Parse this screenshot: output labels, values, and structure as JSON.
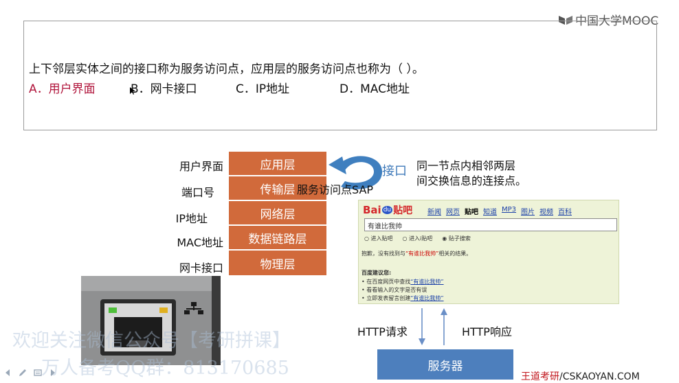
{
  "logo": {
    "text": "中国大学MOOC"
  },
  "question": {
    "text": "上下邻层实体之间的接口称为服务访问点，应用层的服务访问点也称为（        ）。",
    "options": [
      {
        "label": "A．用户界面"
      },
      {
        "label": "B．网卡接口"
      },
      {
        "label": "C．IP地址"
      },
      {
        "label": "D．MAC地址"
      }
    ]
  },
  "layers": [
    {
      "name": "应用层",
      "label": "用户界面"
    },
    {
      "name": "传输层",
      "label": "端口号"
    },
    {
      "name": "网络层",
      "label": "IP地址"
    },
    {
      "name": "数据链路层",
      "label": "MAC地址"
    },
    {
      "name": "物理层",
      "label": "网卡接口"
    }
  ],
  "sap_label": "服务访问点SAP",
  "interface_label": "接口",
  "interface_desc": [
    "同一节点内相邻两层",
    "间交换信息的连接点。"
  ],
  "baidu": {
    "logo_text": "Bai",
    "logo_paw": "du",
    "logo_tieba": "贴吧",
    "nav": [
      "新闻",
      "网页",
      "贴吧",
      "知道",
      "MP3",
      "图片",
      "视频",
      "百科"
    ],
    "search_value": "有谁比我帅",
    "radios": [
      "进入贴吧",
      "进入i贴吧",
      "贴子搜索"
    ],
    "sorry_prefix": "抱歉，没有找到与",
    "sorry_keyword": "“有谁比我帅”",
    "sorry_suffix": "相关的结果。",
    "suggest_title": "百度建议您:",
    "suggest_1_prefix": "在百度网页中查找",
    "suggest_1_link": "“有谁比我帅”",
    "suggest_2": "看看输入的文字是否有误",
    "suggest_3_prefix": "立即发表留言创建",
    "suggest_3_link": "“有谁比我帅”"
  },
  "http_request": "HTTP请求",
  "http_response": "HTTP响应",
  "server_label": "服务器",
  "watermark": [
    "欢迎关注微信公众号【考研拼课】",
    "万人备考QQ群：813170685"
  ],
  "footer": {
    "part1": "王道考研",
    "part2": "/CSKAOYAN.COM"
  }
}
